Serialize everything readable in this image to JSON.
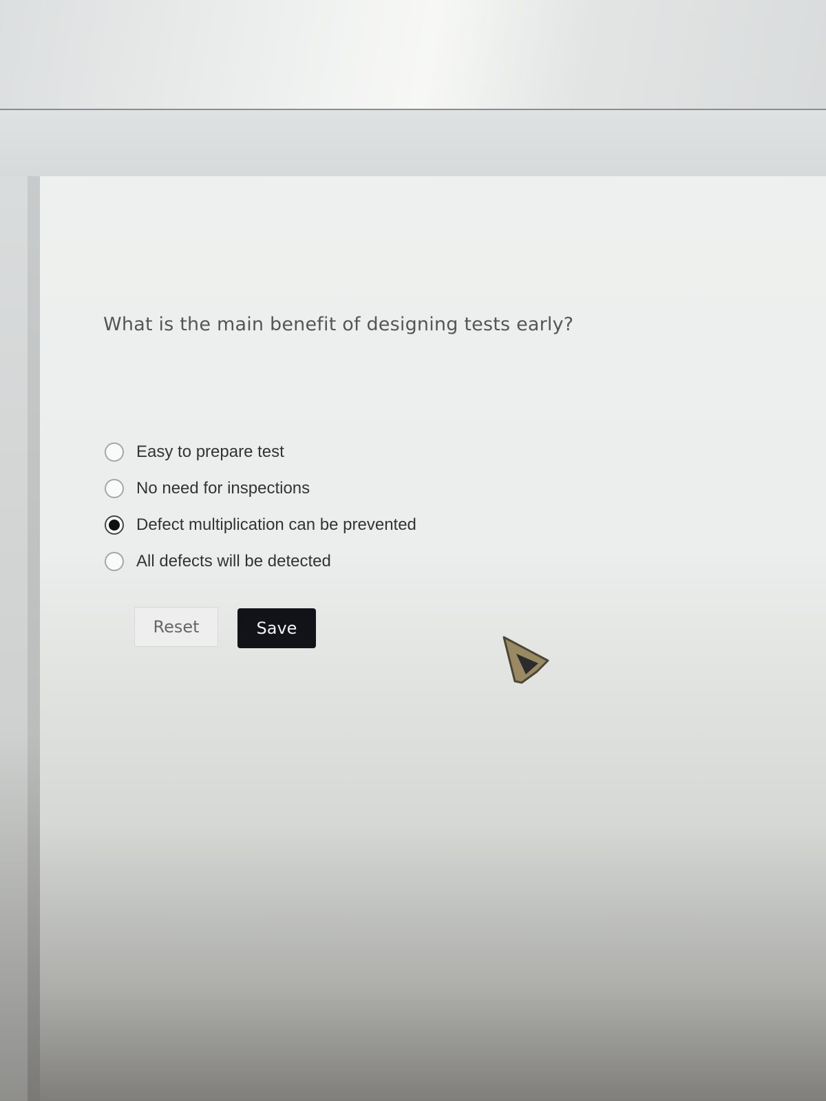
{
  "quiz": {
    "question": "What is the main benefit of designing tests early?",
    "options": [
      {
        "label": "Easy to prepare test",
        "selected": false
      },
      {
        "label": "No need for inspections",
        "selected": false
      },
      {
        "label": "Defect multiplication can be prevented",
        "selected": true
      },
      {
        "label": "All defects will be detected",
        "selected": false
      }
    ],
    "reset_label": "Reset",
    "save_label": "Save"
  },
  "icons": {
    "radio_unselected": "radio-empty-icon",
    "radio_selected": "radio-filled-icon",
    "cursor": "mouse-pointer-icon"
  },
  "colors": {
    "save_button_bg": "#111318",
    "reset_button_bg": "#eeeeee",
    "question_text": "#555555"
  }
}
